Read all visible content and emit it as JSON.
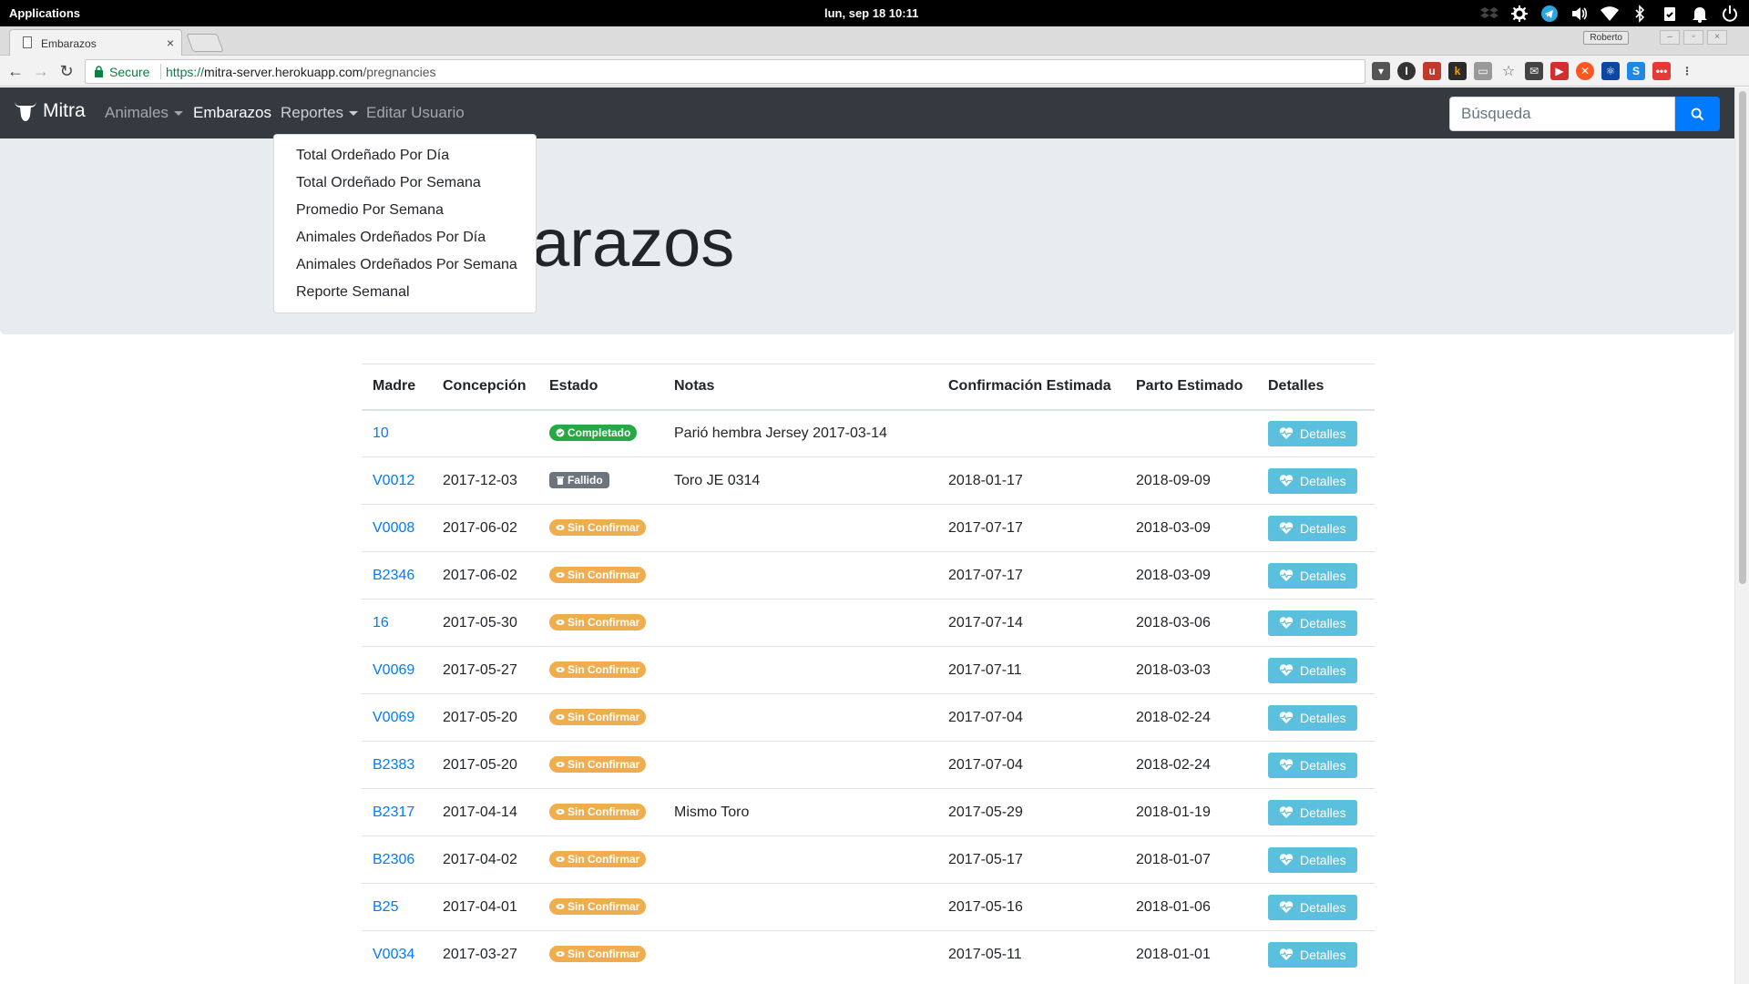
{
  "os": {
    "apps_label": "Applications",
    "clock": "lun, sep 18   10:11"
  },
  "browser": {
    "tab_title": "Embarazos",
    "profile_name": "Roberto",
    "secure_label": "Secure",
    "url_scheme": "https://",
    "url_host": "mitra-server.herokuapp.com",
    "url_path": "/pregnancies"
  },
  "navbar": {
    "brand": "Mitra",
    "links": {
      "animales": "Animales",
      "embarazos": "Embarazos",
      "reportes": "Reportes",
      "editar_usuario": "Editar Usuario"
    },
    "search_placeholder": "Búsqueda"
  },
  "dropdown": {
    "items": [
      "Total Ordeñado Por Día",
      "Total Ordeñado Por Semana",
      "Promedio Por Semana",
      "Animales Ordeñados Por Día",
      "Animales Ordeñados Por Semana",
      "Reporte Semanal"
    ]
  },
  "page": {
    "title": "Embarazos"
  },
  "table": {
    "headers": {
      "madre": "Madre",
      "concepcion": "Concepción",
      "estado": "Estado",
      "notas": "Notas",
      "confirmacion": "Confirmación Estimada",
      "parto": "Parto Estimado",
      "detalles": "Detalles"
    },
    "button_label": "Detalles",
    "rows": [
      {
        "madre": "10",
        "concepcion": "",
        "estado": "Completado",
        "estado_type": "success",
        "notas": "Parió hembra Jersey 2017-03-14",
        "confirmacion": "",
        "parto": ""
      },
      {
        "madre": "V0012",
        "concepcion": "2017-12-03",
        "estado": "Fallido",
        "estado_type": "secondary",
        "notas": "Toro JE 0314",
        "confirmacion": "2018-01-17",
        "parto": "2018-09-09"
      },
      {
        "madre": "V0008",
        "concepcion": "2017-06-02",
        "estado": "Sin Confirmar",
        "estado_type": "warning",
        "notas": "",
        "confirmacion": "2017-07-17",
        "parto": "2018-03-09"
      },
      {
        "madre": "B2346",
        "concepcion": "2017-06-02",
        "estado": "Sin Confirmar",
        "estado_type": "warning",
        "notas": "",
        "confirmacion": "2017-07-17",
        "parto": "2018-03-09"
      },
      {
        "madre": "16",
        "concepcion": "2017-05-30",
        "estado": "Sin Confirmar",
        "estado_type": "warning",
        "notas": "",
        "confirmacion": "2017-07-14",
        "parto": "2018-03-06"
      },
      {
        "madre": "V0069",
        "concepcion": "2017-05-27",
        "estado": "Sin Confirmar",
        "estado_type": "warning",
        "notas": "",
        "confirmacion": "2017-07-11",
        "parto": "2018-03-03"
      },
      {
        "madre": "V0069",
        "concepcion": "2017-05-20",
        "estado": "Sin Confirmar",
        "estado_type": "warning",
        "notas": "",
        "confirmacion": "2017-07-04",
        "parto": "2018-02-24"
      },
      {
        "madre": "B2383",
        "concepcion": "2017-05-20",
        "estado": "Sin Confirmar",
        "estado_type": "warning",
        "notas": "",
        "confirmacion": "2017-07-04",
        "parto": "2018-02-24"
      },
      {
        "madre": "B2317",
        "concepcion": "2017-04-14",
        "estado": "Sin Confirmar",
        "estado_type": "warning",
        "notas": "Mismo Toro",
        "confirmacion": "2017-05-29",
        "parto": "2018-01-19"
      },
      {
        "madre": "B2306",
        "concepcion": "2017-04-02",
        "estado": "Sin Confirmar",
        "estado_type": "warning",
        "notas": "",
        "confirmacion": "2017-05-17",
        "parto": "2018-01-07"
      },
      {
        "madre": "B25",
        "concepcion": "2017-04-01",
        "estado": "Sin Confirmar",
        "estado_type": "warning",
        "notas": "",
        "confirmacion": "2017-05-16",
        "parto": "2018-01-06"
      },
      {
        "madre": "V0034",
        "concepcion": "2017-03-27",
        "estado": "Sin Confirmar",
        "estado_type": "warning",
        "notas": "",
        "confirmacion": "2017-05-11",
        "parto": "2018-01-01"
      }
    ]
  },
  "colors": {
    "navbar": "#343a40",
    "primary": "#007bff",
    "success": "#28a745",
    "warning": "#f0ad4e",
    "info": "#5bc0de",
    "secondary": "#6c757d"
  },
  "icons": {
    "brand": "bull-head-icon",
    "search": "search-icon",
    "completed": "check-circle-icon",
    "failed": "trash-icon",
    "unconfirmed": "eye-icon",
    "details": "heartbeat-icon"
  }
}
